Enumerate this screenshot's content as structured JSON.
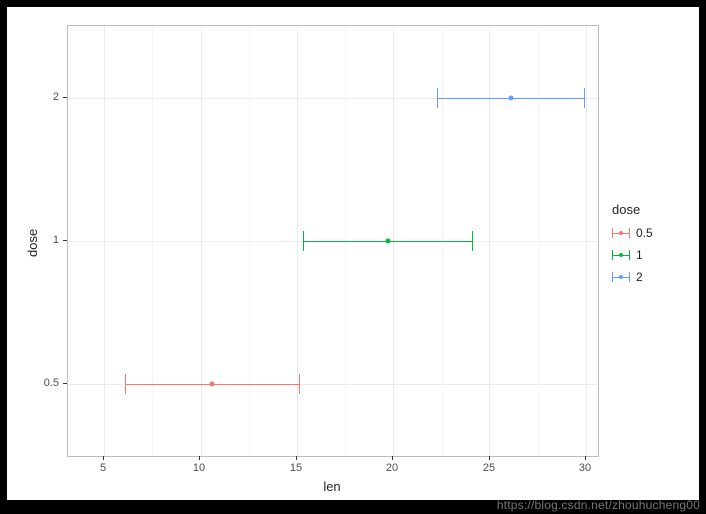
{
  "chart_data": {
    "type": "errorbar",
    "orientation": "horizontal",
    "xlabel": "len",
    "ylabel": "dose",
    "xlim": [
      5,
      30
    ],
    "x_ticks": [
      5,
      10,
      15,
      20,
      25,
      30
    ],
    "y_categories": [
      "0.5",
      "1",
      "2"
    ],
    "series": [
      {
        "name": "0.5",
        "y": "0.5",
        "mean": 10.6,
        "lower": 6.1,
        "upper": 15.1,
        "color": "#F8766D"
      },
      {
        "name": "1",
        "y": "1",
        "mean": 19.7,
        "lower": 15.3,
        "upper": 24.1,
        "color": "#00BA38"
      },
      {
        "name": "2",
        "y": "2",
        "mean": 26.1,
        "lower": 22.3,
        "upper": 29.9,
        "color": "#619CFF"
      }
    ],
    "legend": {
      "title": "dose",
      "items": [
        "0.5",
        "1",
        "2"
      ],
      "position": "right"
    }
  },
  "axis": {
    "x_ticks": [
      "5",
      "10",
      "15",
      "20",
      "25",
      "30"
    ],
    "y_ticks": [
      "0.5",
      "1",
      "2"
    ],
    "x_title": "len",
    "y_title": "dose"
  },
  "legend": {
    "title": "dose",
    "items": [
      {
        "label": "0.5"
      },
      {
        "label": "1"
      },
      {
        "label": "2"
      }
    ]
  },
  "watermark": "https://blog.csdn.net/zhouhucheng00"
}
